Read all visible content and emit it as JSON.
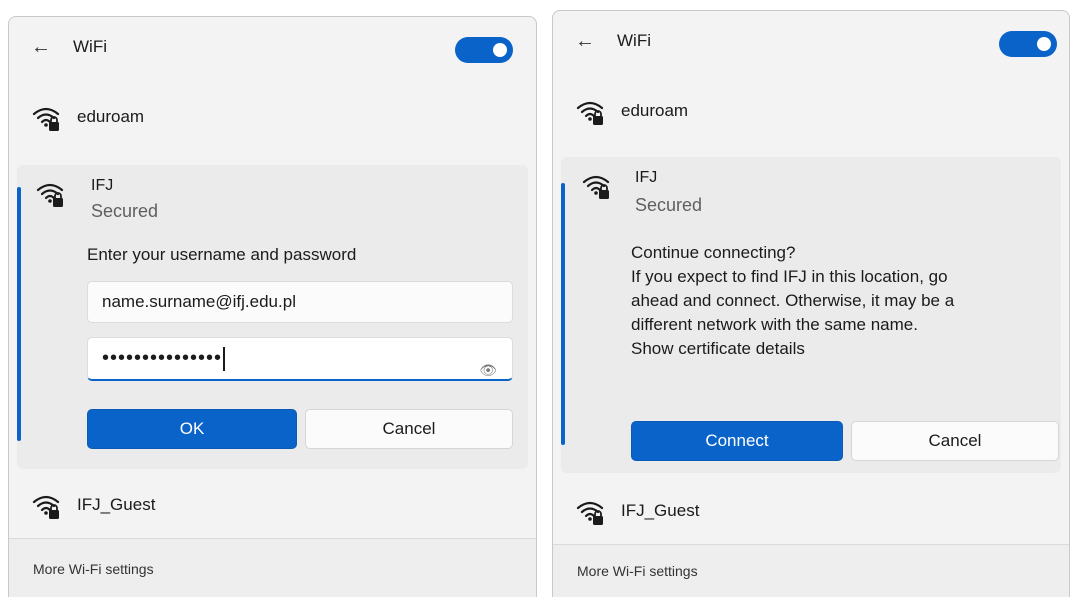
{
  "left": {
    "header": {
      "back": "←",
      "title": "WiFi"
    },
    "networks": {
      "eduroam": "eduroam",
      "guest": "IFJ_Guest"
    },
    "selected": {
      "name": "IFJ",
      "status": "Secured"
    },
    "form": {
      "prompt": "Enter your username and password",
      "username": "name.surname@ifj.edu.pl",
      "password_mask": "•••••••••••••••",
      "eye": "👁"
    },
    "buttons": {
      "ok": "OK",
      "cancel": "Cancel"
    },
    "footer": "More Wi-Fi settings"
  },
  "right": {
    "header": {
      "back": "←",
      "title": "WiFi"
    },
    "networks": {
      "eduroam": "eduroam",
      "guest": "IFJ_Guest"
    },
    "selected": {
      "name": "IFJ",
      "status": "Secured"
    },
    "message": {
      "line1": "Continue connecting?",
      "line2": "If you expect to find IFJ in this location, go",
      "line3": "ahead and connect. Otherwise, it may be a",
      "line4": "different network with the same name.",
      "line5": "Show certificate details"
    },
    "buttons": {
      "connect": "Connect",
      "cancel": "Cancel"
    },
    "footer": "More Wi-Fi settings"
  },
  "colors": {
    "accent": "#0a63c9",
    "panel": "#f3f3f3",
    "expanded": "#ebebeb"
  },
  "toggle_state": "on"
}
